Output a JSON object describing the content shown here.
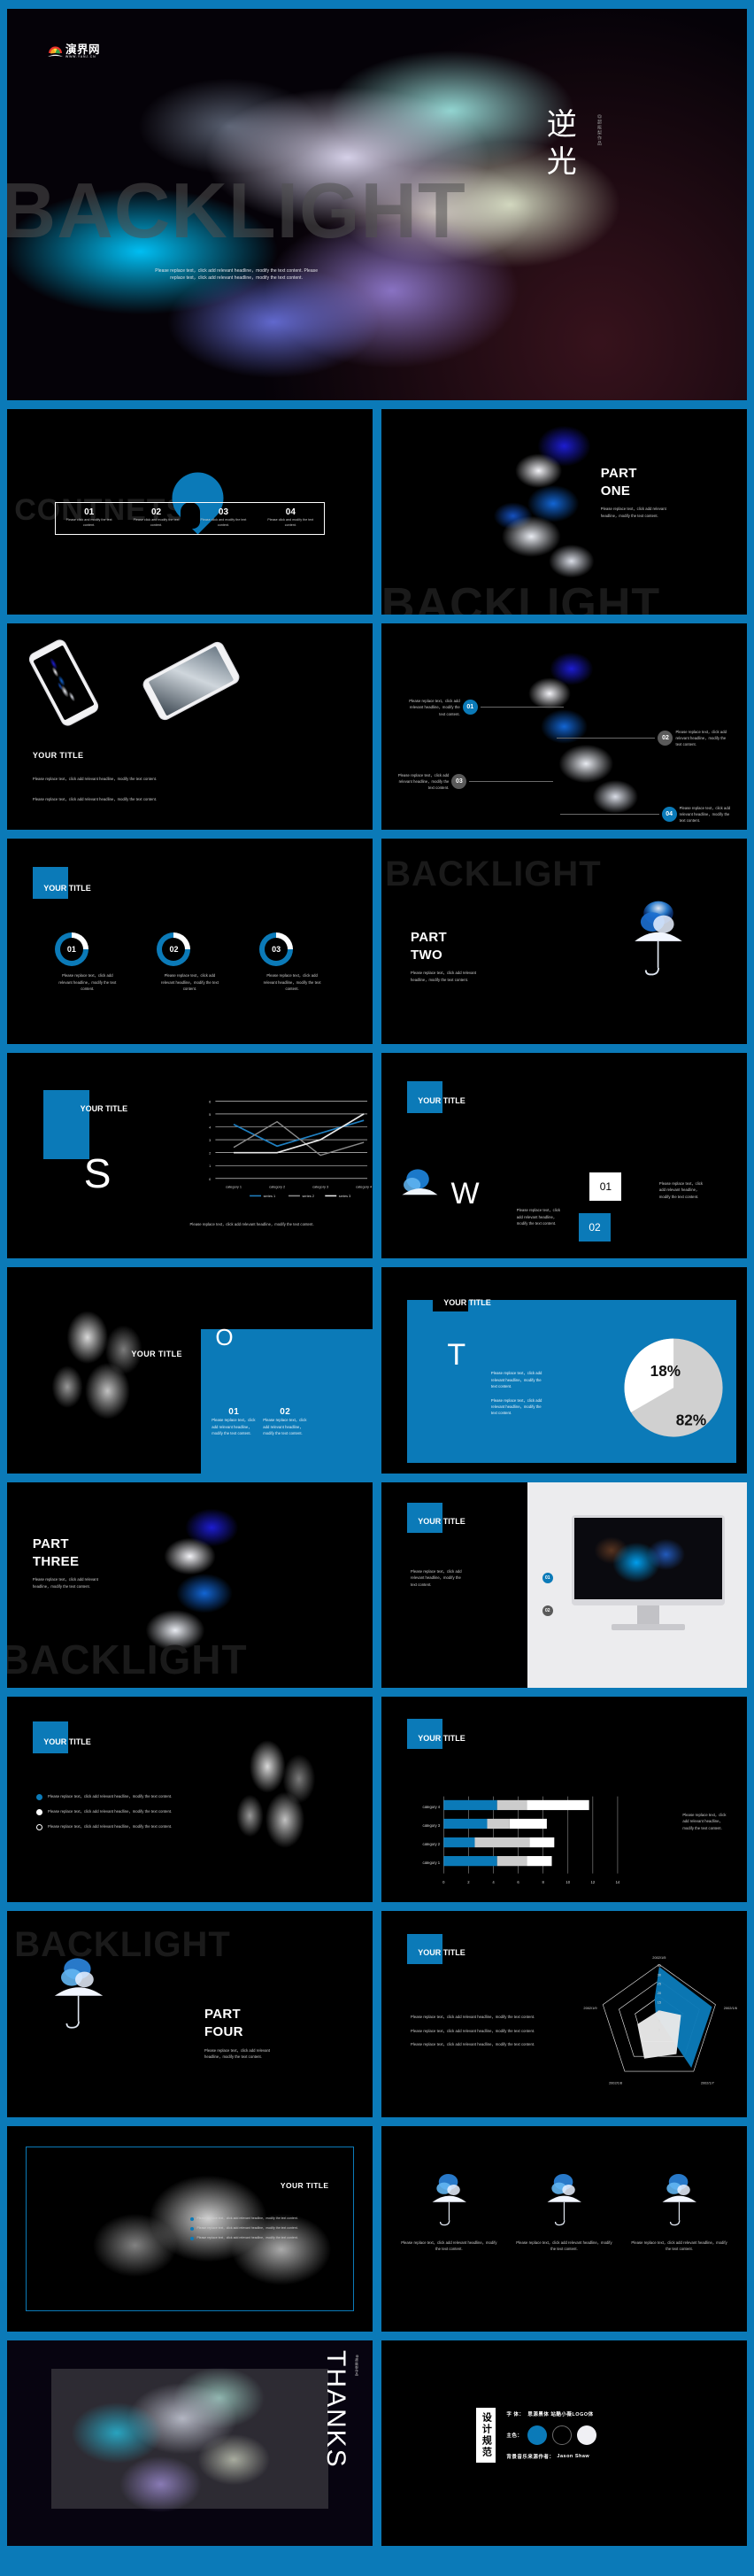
{
  "theme": {
    "accent": "#0b7ab8",
    "dark": "#000000",
    "light": "#ffffff",
    "grey": "#d0d0d0"
  },
  "brand": {
    "name": "演界网",
    "url": "WWW.YANJ.CN"
  },
  "ghost_word": "BACKLIGHT",
  "cover": {
    "title_line1": "逆",
    "title_line2": "光",
    "author": "@超能梨作品",
    "desc_line1": "Please replace text，click add relevant headline，modify the text content. Please",
    "desc_line2": "replace text，click add relevant headline，modify the text content."
  },
  "contents": {
    "ghost": "CONTNETS",
    "items": [
      {
        "num": "01",
        "text": "Please click and modify the text content."
      },
      {
        "num": "02",
        "text": "Please click and modify the text content."
      },
      {
        "num": "03",
        "text": "Please click and modify the text content."
      },
      {
        "num": "04",
        "text": "Please click and modify the text content."
      }
    ]
  },
  "common": {
    "your_title": "YOUR TITLE",
    "para": "Please replace text，click add relevant headline，modify the text content.",
    "para_short": "Please replace text，click add relevant headline，modify the text content."
  },
  "parts": [
    {
      "line1": "PART",
      "line2": "ONE",
      "desc": "Please replace text，click add relevant headline，modify the text content."
    },
    {
      "line1": "PART",
      "line2": "TWO",
      "desc": "Please replace text，click add relevant headline，modify the text content."
    },
    {
      "line1": "PART",
      "line2": "THREE",
      "desc": "Please replace text，click add relevant headline，modify the text content."
    },
    {
      "line1": "PART",
      "line2": "FOUR",
      "desc": "Please replace text，click add relevant headline，modify the text content."
    }
  ],
  "callouts": {
    "items": [
      {
        "num": "01",
        "text": "Please replace text，click add relevant headline，modify the text content."
      },
      {
        "num": "02",
        "text": "Please replace text，click add relevant headline，modify the text content."
      },
      {
        "num": "03",
        "text": "Please replace text，click add relevant headline，modify the text content."
      },
      {
        "num": "04",
        "text": "Please replace text，click add relevant headline，modify the text content."
      }
    ]
  },
  "donuts": {
    "items": [
      {
        "num": "01",
        "text": "Please replace text，click add relevant headline，modify the text content."
      },
      {
        "num": "02",
        "text": "Please replace text，click add relevant headline，modify the text content."
      },
      {
        "num": "03",
        "text": "Please replace text，click add relevant headline，modify the text content."
      }
    ]
  },
  "swot": {
    "s": {
      "letter": "S",
      "desc1": "Please replace text，click add relevant headline，modify the text content.",
      "desc2": "Please replace text，click add relevant headline，modify the text content."
    },
    "w": {
      "letter": "W",
      "desc": "Please replace text，click add relevant headline，modify the text content.",
      "n1": "01",
      "n1_text": "Please replace text，click add relevant headline，modify the text content.",
      "n2": "02"
    },
    "o": {
      "letter": "O",
      "n1": "01",
      "n1_text": "Please replace text，click add relevant headline，modify the text content.",
      "n2": "02",
      "n2_text": "Please replace text，click add relevant headline，modify the text content."
    },
    "t": {
      "letter": "T",
      "desc1": "Please replace text，click add relevant headline，modify the text content.",
      "desc2": "Please replace text，click add relevant headline，modify the text content."
    }
  },
  "bullets": {
    "items": [
      "Please replace text，click add relevant headline，modify the text content.",
      "Please replace text，click add relevant headline，modify the text content.",
      "Please replace text，click add relevant headline，modify the text content."
    ]
  },
  "imac_slide": {
    "desc": "Please replace text，click add relevant headline，modify the text content.",
    "n1": "01",
    "n2": "02"
  },
  "triple": {
    "items": [
      "Please replace text，click add relevant headline，modify the text content.",
      "Please replace text，click add relevant headline，modify the text content.",
      "Please replace text，click add relevant headline，modify the text content."
    ]
  },
  "framed": {
    "items": [
      "Please replace text，click add relevant headline，modify the text content.",
      "Please replace text，click add relevant headline，modify the text content.",
      "Please replace text，click add relevant headline，modify the text content."
    ]
  },
  "thanks": {
    "word": "THANKS",
    "author": "@超能梨作品"
  },
  "spec": {
    "heading": "设计规范",
    "font_label": "字 体：",
    "font_value": "思源黑体 站酷小薇LOGO体",
    "color_label": "主色：",
    "swatches": [
      "#0b7ab8",
      "#000000",
      "#f0f0f4"
    ],
    "music_label": "背景音乐来源作者：",
    "music_value": "Jason Shaw"
  },
  "chart_data": [
    {
      "type": "line",
      "title": "",
      "categories": [
        "category 1",
        "category 2",
        "category 3",
        "category 4"
      ],
      "series": [
        {
          "name": "series 1",
          "values": [
            4.3,
            2.5,
            3.5,
            4.5
          ],
          "color": "#1f7fc0"
        },
        {
          "name": "series 2",
          "values": [
            2.4,
            4.4,
            1.8,
            2.8
          ],
          "color": "#8a8a8a"
        },
        {
          "name": "series 3",
          "values": [
            2.0,
            2.0,
            3.0,
            5.0
          ],
          "color": "#e8e8e8"
        }
      ],
      "ylim": [
        0,
        6
      ],
      "yticks": [
        0,
        1,
        2,
        3,
        4,
        5,
        6
      ],
      "xlabel": "",
      "ylabel": "",
      "grid": true,
      "legend": "bottom"
    },
    {
      "type": "pie",
      "title": "",
      "labels": [
        "18%",
        "82%"
      ],
      "values": [
        18,
        82
      ],
      "colors": [
        "#ffffff",
        "#d0d0d0"
      ]
    },
    {
      "type": "bar",
      "orientation": "horizontal",
      "stacked": true,
      "title": "",
      "categories": [
        "category 1",
        "category 2",
        "category 3",
        "category 4"
      ],
      "series": [
        {
          "name": "series 1",
          "values": [
            4.3,
            2.5,
            3.5,
            4.5
          ],
          "color": "#0b7ab8"
        },
        {
          "name": "series 2",
          "values": [
            2.4,
            4.4,
            1.8,
            2.8
          ],
          "color": "#cccccc"
        },
        {
          "name": "series 3",
          "values": [
            2.0,
            2.0,
            3.0,
            5.0
          ],
          "color": "#ffffff"
        }
      ],
      "xlim": [
        0,
        14
      ],
      "xticks": [
        0,
        2,
        4,
        6,
        8,
        10,
        12,
        14
      ],
      "grid": true,
      "legend": "none"
    },
    {
      "type": "radar",
      "title": "",
      "categories": [
        "2002/1/5",
        "2002/1/6",
        "2002/1/7",
        "2002/1/8",
        "2002/1/9"
      ],
      "rticks": [
        0,
        5,
        10,
        15,
        20,
        25,
        30,
        35
      ],
      "rmax": 35,
      "series": [
        {
          "name": "series 1",
          "values": [
            33,
            26,
            20,
            9,
            10
          ],
          "color": "#0b7ab8"
        },
        {
          "name": "series 2",
          "values": [
            14,
            12,
            9,
            13,
            16
          ],
          "color": "#e8e8e8"
        }
      ],
      "legend": "none"
    }
  ]
}
